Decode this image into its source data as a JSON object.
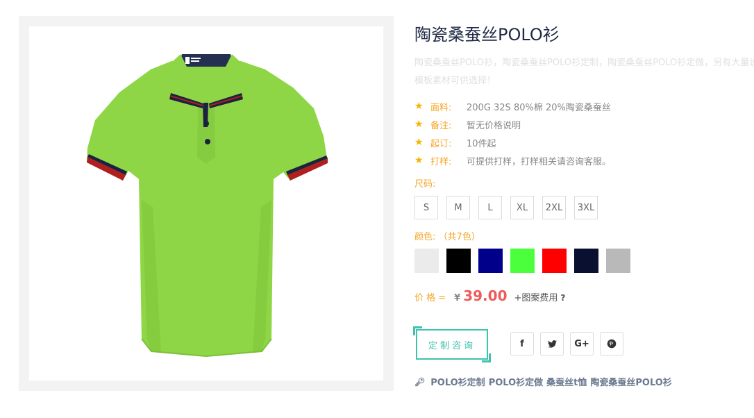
{
  "product": {
    "title": "陶瓷桑蚕丝POLO衫",
    "description": "陶瓷桑蚕丝POLO衫，陶瓷桑蚕丝POLO衫定制，陶瓷桑蚕丝POLO衫定做，另有大量设计模板素材可供选择！",
    "specs": [
      {
        "label": "面料:",
        "value": "200G 32S 80%棉 20%陶瓷桑蚕丝"
      },
      {
        "label": "备注:",
        "value": "暂无价格说明"
      },
      {
        "label": "起订:",
        "value": "10件起"
      },
      {
        "label": "打样:",
        "value": "可提供打样，打样相关请咨询客服。"
      }
    ],
    "size_label": "尺码:",
    "sizes": [
      "S",
      "M",
      "L",
      "XL",
      "2XL",
      "3XL"
    ],
    "color_label": "颜色: （共7色）",
    "colors": [
      "#ebebeb",
      "#000000",
      "#00008b",
      "#4cff3c",
      "#ff0000",
      "#0a1130",
      "#b9b9b9"
    ],
    "price_label": "价 格 =",
    "currency": "¥",
    "price": "39.00",
    "price_extra": "+图案费用",
    "price_help": "?",
    "consult_label": "定制咨询",
    "social": [
      {
        "icon": "facebook-icon",
        "glyph": "f"
      },
      {
        "icon": "twitter-icon",
        "glyph": "t"
      },
      {
        "icon": "google-plus-icon",
        "glyph": "G+"
      },
      {
        "icon": "pinterest-icon",
        "glyph": "p"
      }
    ],
    "tags": [
      "POLO衫定制",
      "POLO衫定做",
      "桑蚕丝t恤",
      "陶瓷桑蚕丝POLO衫"
    ],
    "shirt_color": "#8fd646",
    "accent": "#3ec1ad"
  }
}
